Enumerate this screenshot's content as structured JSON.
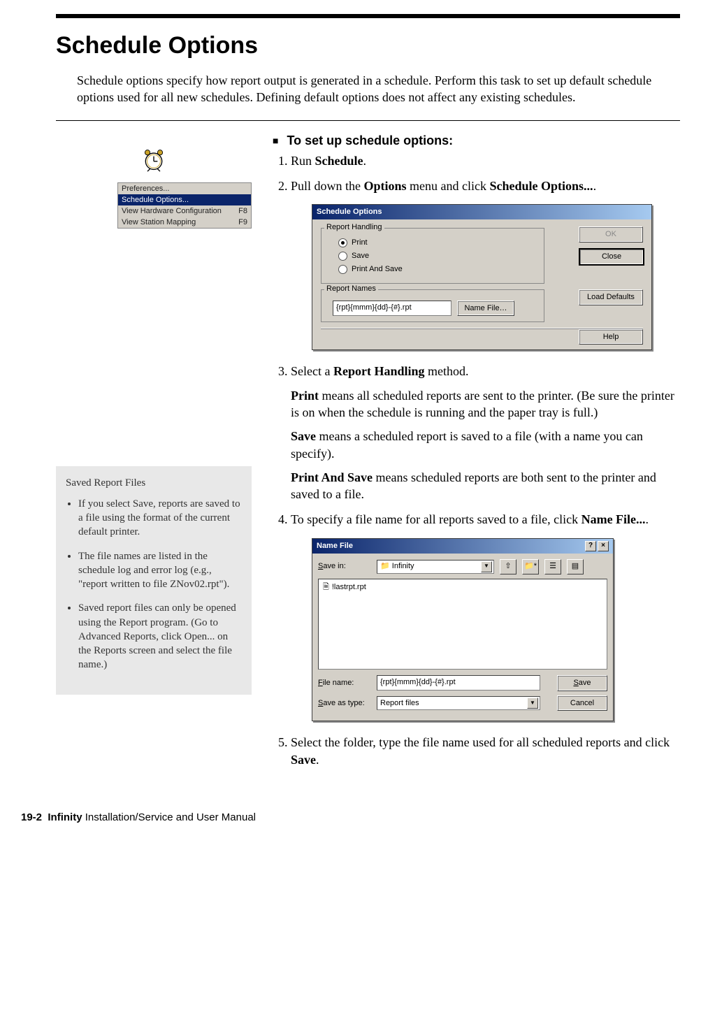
{
  "heading": "Schedule Options",
  "intro": "Schedule options specify how report output is generated in a schedule. Perform this task to set up default schedule options used for all new schedules. Defining default options does not affect any existing schedules.",
  "menu": {
    "items": [
      {
        "label": "Preferences...",
        "shortcut": ""
      },
      {
        "label": "Schedule Options...",
        "shortcut": ""
      },
      {
        "label": "View Hardware Configuration",
        "shortcut": "F8"
      },
      {
        "label": "View Station Mapping",
        "shortcut": "F9"
      }
    ]
  },
  "sidebar": {
    "title": "Saved Report Files",
    "items": [
      "If you select Save, reports are saved to a file using the format of the current default printer.",
      "The file names are listed in the schedule log and error log (e.g., \"report written to file ZNov02.rpt\").",
      "Saved report files can only be opened using the Report program. (Go to Advanced Reports, click Open... on the Reports screen and select the file name.)"
    ]
  },
  "procedure": {
    "title": "To set up schedule options:",
    "step1_pre": "Run ",
    "step1_b": "Schedule",
    "step1_post": ".",
    "step2_pre": "Pull down the ",
    "step2_b1": "Options",
    "step2_mid": " menu and click ",
    "step2_b2": "Schedule Options...",
    "step2_post": ".",
    "step3_pre": "Select a ",
    "step3_b": "Report Handling",
    "step3_post": " method.",
    "step3_p1_b": "Print",
    "step3_p1": " means all scheduled reports are sent to the printer. (Be sure the printer is on when the schedule is running and the paper tray is full.)",
    "step3_p2_b": "Save",
    "step3_p2": " means a scheduled report is saved to a file (with a name you can specify).",
    "step3_p3_b": "Print And Save",
    "step3_p3": " means scheduled reports are both sent to the printer and saved to a file.",
    "step4_pre": "To specify a file name for all reports saved to a file, click ",
    "step4_b": "Name File...",
    "step4_post": ".",
    "step5_pre": "Select the folder, type the file name used for all scheduled reports and click ",
    "step5_b": "Save",
    "step5_post": "."
  },
  "dlg1": {
    "title": "Schedule Options",
    "group1": "Report Handling",
    "opt_print": "Print",
    "opt_save": "Save",
    "opt_both": "Print And Save",
    "group2": "Report Names",
    "name_value": "{rpt}{mmm}{dd}-{#}.rpt",
    "btn_namefile": "Name File…",
    "btn_ok": "OK",
    "btn_close": "Close",
    "btn_defaults": "Load Defaults",
    "btn_help": "Help"
  },
  "dlg2": {
    "title": "Name File",
    "savein_lbl": "Save in:",
    "savein_val": "Infinity",
    "file_item": "!lastrpt.rpt",
    "filename_lbl": "File name:",
    "filename_val": "{rpt}{mmm}{dd}-{#}.rpt",
    "saveas_lbl": "Save as type:",
    "saveas_val": "Report files",
    "btn_save": "Save",
    "btn_cancel": "Cancel"
  },
  "footer": {
    "pagenum": "19-2",
    "product": "Infinity",
    "rest": " Installation/Service and User Manual"
  }
}
